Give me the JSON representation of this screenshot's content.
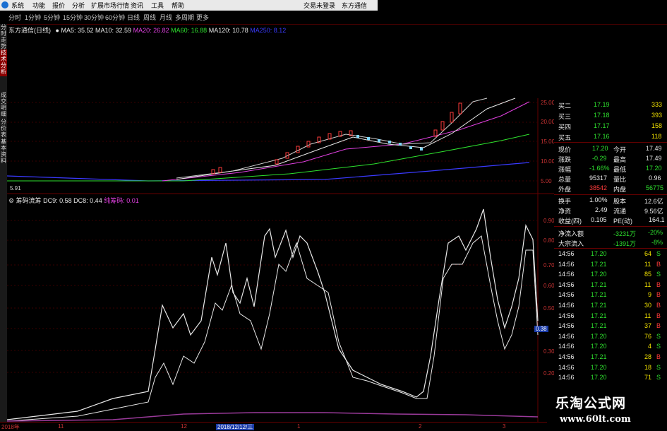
{
  "menubar": {
    "items": [
      "系统",
      "功能",
      "报价",
      "分析",
      "扩展市场行情",
      "资讯",
      "工具",
      "帮助"
    ],
    "status": "交易未登录",
    "brand": "东方通信"
  },
  "toolbar": {
    "periods": [
      "分时",
      "1分钟",
      "5分钟",
      "15分钟",
      "30分钟",
      "60分钟",
      "日线",
      "周线",
      "月线",
      "多周期",
      "更多"
    ]
  },
  "left_tabs": [
    "分时走势",
    "技术分析",
    "成交明细",
    "分价表",
    "基本资料"
  ],
  "main_chart": {
    "stock": "东方通信(日线)",
    "ma": [
      {
        "label": "MA5: 35.52",
        "color": "#e8e8e8"
      },
      {
        "label": "MA10: 32.59",
        "color": "#e8e8e8"
      },
      {
        "label": "MA20: 26.82",
        "color": "#e040e0"
      },
      {
        "label": "MA60: 16.88",
        "color": "#2ee12e"
      },
      {
        "label": "MA120: 10.78",
        "color": "#e8e8e8"
      },
      {
        "label": "MA250: 8.12",
        "color": "#3a3aff"
      }
    ],
    "y_ticks": [
      "25.00",
      "20.00",
      "15.00",
      "10.00",
      "5.00"
    ],
    "low_label": "5.91"
  },
  "indicator": {
    "name": "筹码流筹",
    "dc9": "DC9: 0.58",
    "dc8": "DC8: 0.44",
    "extra": "纯筹码: 0.01",
    "y_ticks": [
      "0.90",
      "0.80",
      "0.70",
      "0.60",
      "0.50",
      "0.40",
      "0.30",
      "0.20"
    ],
    "current": "0.38"
  },
  "dates": [
    "2018年",
    "11",
    "12",
    "2018/12/12/三",
    "1",
    "2",
    "3"
  ],
  "quote": {
    "bids": [
      {
        "label": "买二",
        "price": "17.19",
        "vol": "333"
      },
      {
        "label": "买三",
        "price": "17.18",
        "vol": "393"
      },
      {
        "label": "买四",
        "price": "17.17",
        "vol": "158"
      },
      {
        "label": "买五",
        "price": "17.16",
        "vol": "118"
      }
    ],
    "stats": [
      {
        "l1": "现价",
        "v1": "17.20",
        "c1": "green",
        "l2": "今开",
        "v2": "17.49",
        "c2": "white"
      },
      {
        "l1": "涨跌",
        "v1": "-0.29",
        "c1": "green",
        "l2": "最高",
        "v2": "17.49",
        "c2": "white"
      },
      {
        "l1": "涨幅",
        "v1": "-1.66%",
        "c1": "green",
        "l2": "最低",
        "v2": "17.20",
        "c2": "green"
      },
      {
        "l1": "总量",
        "v1": "95317",
        "c1": "white",
        "l2": "量比",
        "v2": "0.96",
        "c2": "white"
      },
      {
        "l1": "外盘",
        "v1": "38542",
        "c1": "red",
        "l2": "内盘",
        "v2": "56775",
        "c2": "green"
      }
    ],
    "stats2": [
      {
        "l1": "换手",
        "v1": "1.00%",
        "l2": "股本",
        "v2": "12.6亿"
      },
      {
        "l1": "净资",
        "v1": "2.49",
        "l2": "流通",
        "v2": "9.56亿"
      },
      {
        "l1": "收益(四)",
        "v1": "0.105",
        "l2": "PE(动)",
        "v2": "164.1"
      }
    ],
    "flows": [
      {
        "label": "净流入额",
        "value": "-3231万",
        "pct": "-20%"
      },
      {
        "label": "大宗流入",
        "value": "-1391万",
        "pct": "-8%"
      }
    ],
    "ticks": [
      {
        "t": "14:56",
        "p": "17.20",
        "v": "64",
        "s": "S"
      },
      {
        "t": "14:56",
        "p": "17.21",
        "v": "11",
        "s": "B"
      },
      {
        "t": "14:56",
        "p": "17.20",
        "v": "85",
        "s": "S"
      },
      {
        "t": "14:56",
        "p": "17.21",
        "v": "11",
        "s": "B"
      },
      {
        "t": "14:56",
        "p": "17.21",
        "v": "9",
        "s": "B"
      },
      {
        "t": "14:56",
        "p": "17.21",
        "v": "30",
        "s": "B"
      },
      {
        "t": "14:56",
        "p": "17.21",
        "v": "11",
        "s": "B"
      },
      {
        "t": "14:56",
        "p": "17.21",
        "v": "37",
        "s": "B"
      },
      {
        "t": "14:56",
        "p": "17.20",
        "v": "76",
        "s": "S"
      },
      {
        "t": "14:56",
        "p": "17.20",
        "v": "4",
        "s": "S"
      },
      {
        "t": "14:56",
        "p": "17.21",
        "v": "28",
        "s": "B"
      },
      {
        "t": "14:56",
        "p": "17.20",
        "v": "18",
        "s": "S"
      },
      {
        "t": "14:56",
        "p": "17.20",
        "v": "71",
        "s": "S"
      }
    ]
  },
  "watermark": {
    "title": "乐淘公式网",
    "url": "www.60lt.com"
  }
}
